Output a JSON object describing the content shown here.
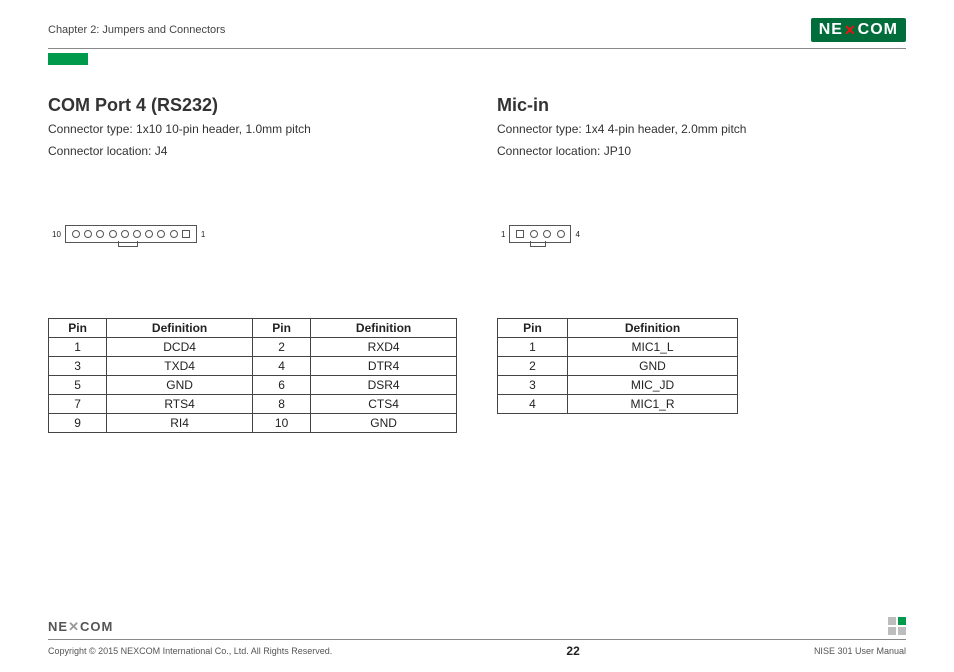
{
  "header": {
    "chapter": "Chapter 2: Jumpers and Connectors",
    "logo_text": "NE COM",
    "logo_x": "✕"
  },
  "section1": {
    "title": "COM Port 4 (RS232)",
    "line1": "Connector type: 1x10 10-pin header, 1.0mm pitch",
    "line2": "Connector location: J4",
    "label_left": "10",
    "label_right": "1",
    "headers": {
      "pin": "Pin",
      "def": "Definition"
    },
    "rows": [
      {
        "p1": "1",
        "d1": "DCD4",
        "p2": "2",
        "d2": "RXD4"
      },
      {
        "p1": "3",
        "d1": "TXD4",
        "p2": "4",
        "d2": "DTR4"
      },
      {
        "p1": "5",
        "d1": "GND",
        "p2": "6",
        "d2": "DSR4"
      },
      {
        "p1": "7",
        "d1": "RTS4",
        "p2": "8",
        "d2": "CTS4"
      },
      {
        "p1": "9",
        "d1": "RI4",
        "p2": "10",
        "d2": "GND"
      }
    ]
  },
  "section2": {
    "title": "Mic-in",
    "line1": "Connector type: 1x4 4-pin header, 2.0mm pitch",
    "line2": "Connector location: JP10",
    "label_left": "1",
    "label_right": "4",
    "headers": {
      "pin": "Pin",
      "def": "Definition"
    },
    "rows": [
      {
        "p": "1",
        "d": "MIC1_L"
      },
      {
        "p": "2",
        "d": "GND"
      },
      {
        "p": "3",
        "d": "MIC_JD"
      },
      {
        "p": "4",
        "d": "MIC1_R"
      }
    ]
  },
  "footer": {
    "logo": "NE✕COM",
    "copyright": "Copyright © 2015 NEXCOM International Co., Ltd. All Rights Reserved.",
    "page": "22",
    "manual": "NISE 301 User Manual"
  }
}
